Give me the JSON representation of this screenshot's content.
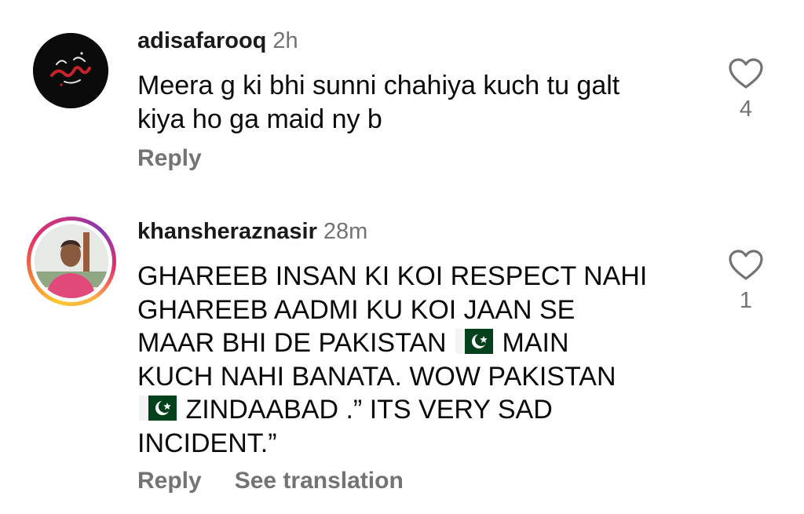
{
  "comments": [
    {
      "username": "adisafarooq",
      "time": "2h",
      "text_lines": [
        "Meera g ki bhi sunni chahiya kuch tu galt",
        "kiya ho ga maid ny b"
      ],
      "likes": "4",
      "actions": {
        "reply": "Reply"
      },
      "avatar_icon": "calligraphy-logo"
    },
    {
      "username": "khansheraznasir",
      "time": "28m",
      "text_parts": {
        "line1": "GHAREEB INSAN KI KOI RESPECT NAHI",
        "line2": "GHAREEB AADMI KU KOI  JAAN SE",
        "line3_pre": "MAAR BHI DE  PAKISTAN ",
        "line3_post": " MAIN",
        "line4": "KUCH NAHI BANATA. WOW PAKISTAN",
        "line5_post": " ZINDAABAD .” ITS VERY SAD",
        "line6": "INCIDENT.”"
      },
      "likes": "1",
      "actions": {
        "reply": "Reply",
        "translate": "See translation"
      },
      "avatar_icon": "profile-photo"
    }
  ],
  "colors": {
    "text": "#0a0a0a",
    "muted": "#737373",
    "flag_green": "#01411c"
  }
}
